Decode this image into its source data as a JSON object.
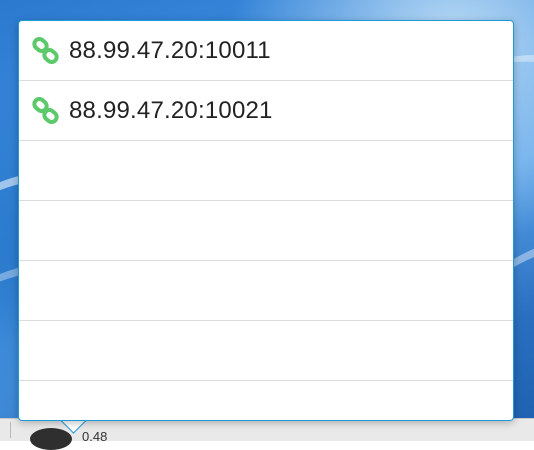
{
  "connections": {
    "items": [
      {
        "address": "88.99.47.20:10011",
        "icon": "link-icon",
        "icon_color": "#5cc96b"
      },
      {
        "address": "88.99.47.20:10021",
        "icon": "link-icon",
        "icon_color": "#5cc96b"
      }
    ],
    "empty_rows": 4
  },
  "taskbar": {
    "text": "0.48"
  },
  "colors": {
    "popover_border": "#1e9bd7",
    "row_divider": "#dcdcdc",
    "link_icon": "#5cc96b"
  }
}
